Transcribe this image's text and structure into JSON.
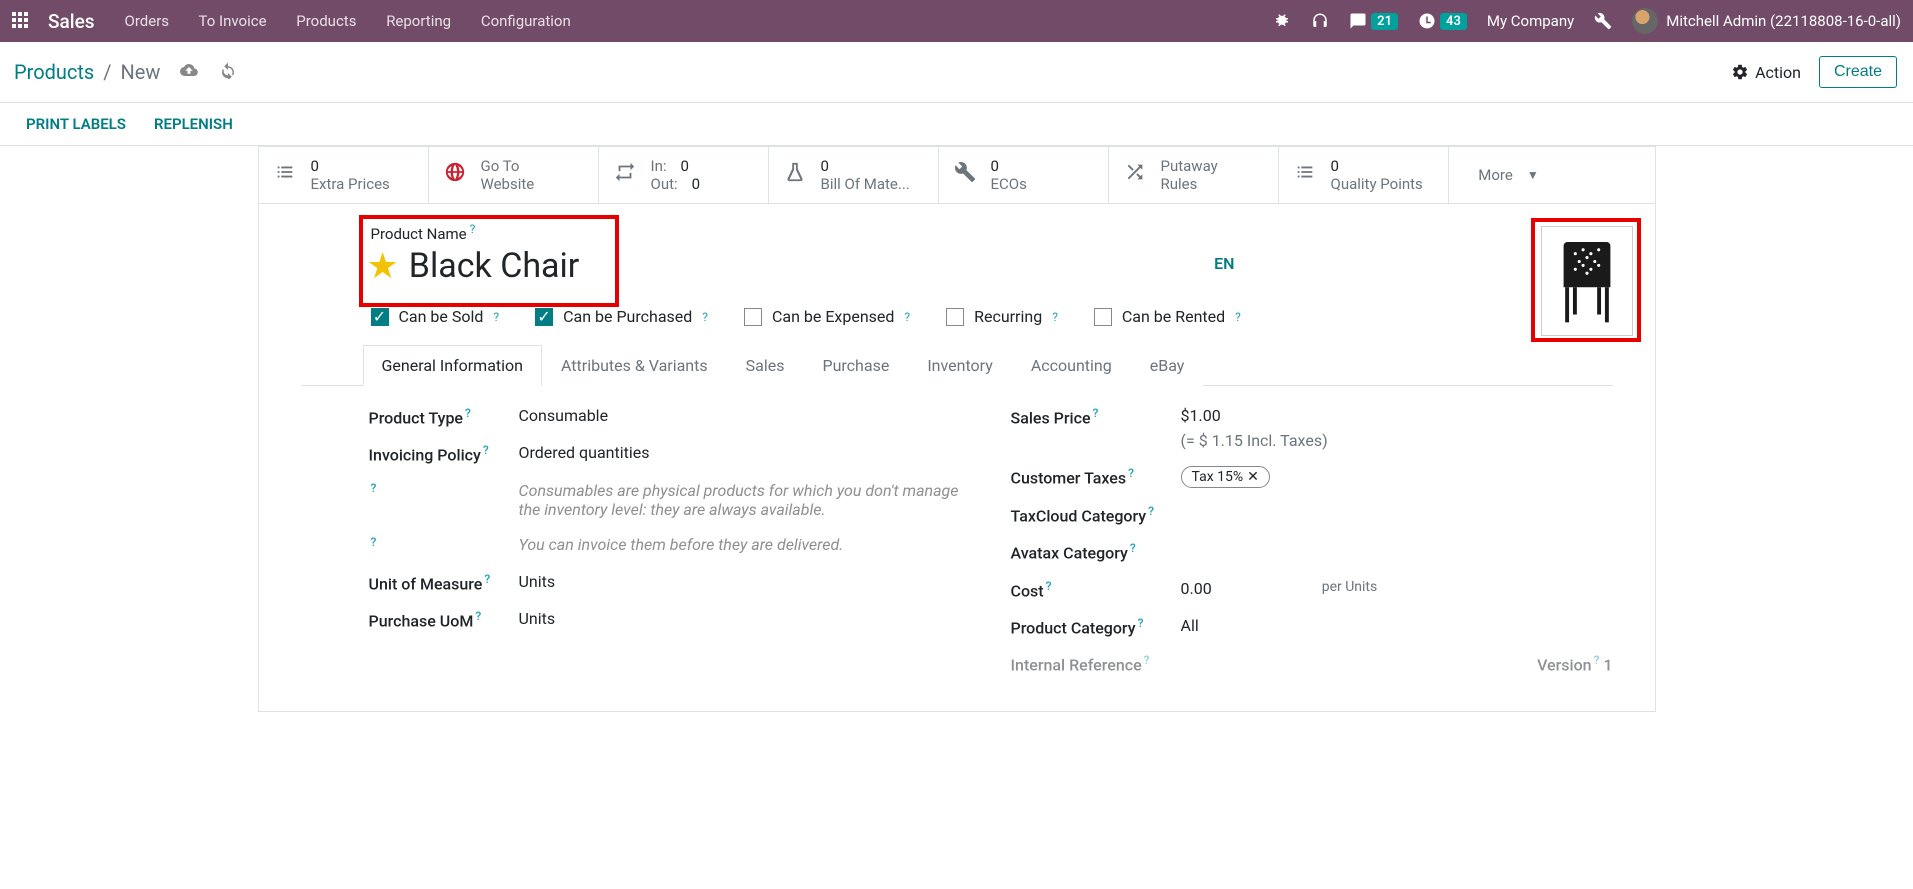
{
  "topnav": {
    "brand": "Sales",
    "menu": [
      "Orders",
      "To Invoice",
      "Products",
      "Reporting",
      "Configuration"
    ],
    "messages_count": "21",
    "activities_count": "43",
    "company": "My Company",
    "user": "Mitchell Admin (22118808-16-0-all)"
  },
  "controlbar": {
    "breadcrumb_root": "Products",
    "breadcrumb_current": "New",
    "action_label": "Action",
    "create_label": "Create"
  },
  "statusbar": {
    "print_labels": "PRINT LABELS",
    "replenish": "REPLENISH"
  },
  "button_box": {
    "extra_prices": {
      "count": "0",
      "label": "Extra Prices"
    },
    "website": {
      "line1": "Go To",
      "line2": "Website"
    },
    "inout": {
      "in_label": "In:",
      "in_val": "0",
      "out_label": "Out:",
      "out_val": "0"
    },
    "bom": {
      "count": "0",
      "label": "Bill Of Mate..."
    },
    "ecos": {
      "count": "0",
      "label": "ECOs"
    },
    "putaway": {
      "line1": "Putaway",
      "line2": "Rules"
    },
    "quality": {
      "count": "0",
      "label": "Quality Points"
    },
    "more": "More"
  },
  "title": {
    "product_name_label": "Product Name",
    "product_name": "Black Chair",
    "lang": "EN"
  },
  "options": {
    "can_be_sold": "Can be Sold",
    "can_be_purchased": "Can be Purchased",
    "can_be_expensed": "Can be Expensed",
    "recurring": "Recurring",
    "can_be_rented": "Can be Rented"
  },
  "tabs": [
    "General Information",
    "Attributes & Variants",
    "Sales",
    "Purchase",
    "Inventory",
    "Accounting",
    "eBay"
  ],
  "form": {
    "left": {
      "product_type_label": "Product Type",
      "product_type_value": "Consumable",
      "invoicing_policy_label": "Invoicing Policy",
      "invoicing_policy_value": "Ordered quantities",
      "help1": "Consumables are physical products for which you don't manage the inventory level: they are always available.",
      "help2": "You can invoice them before they are delivered.",
      "uom_label": "Unit of Measure",
      "uom_value": "Units",
      "puom_label": "Purchase UoM",
      "puom_value": "Units"
    },
    "right": {
      "sales_price_label": "Sales Price",
      "sales_price_value": "$1.00",
      "sales_price_incl": "(= $ 1.15 Incl. Taxes)",
      "customer_taxes_label": "Customer Taxes",
      "customer_taxes_value": "Tax 15%",
      "taxcloud_label": "TaxCloud Category",
      "avatax_label": "Avatax Category",
      "cost_label": "Cost",
      "cost_value": "0.00",
      "cost_per": "per Units",
      "product_category_label": "Product Category",
      "product_category_value": "All",
      "internal_ref_label": "Internal Reference",
      "version_label": "Version",
      "version_value": "1"
    }
  }
}
